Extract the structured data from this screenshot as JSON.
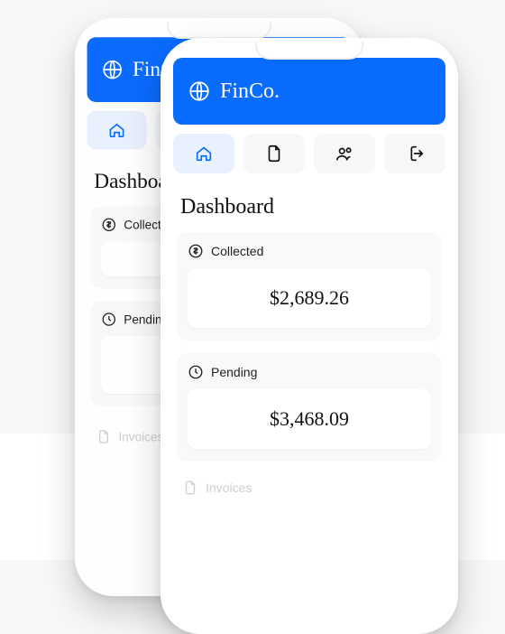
{
  "header": {
    "brand": "FinCo.",
    "icon": "globe-icon",
    "accent_color": "#0a6cff"
  },
  "nav": [
    {
      "name": "home",
      "icon": "home-icon",
      "active": true
    },
    {
      "name": "docs",
      "icon": "document-icon",
      "active": false
    },
    {
      "name": "people",
      "icon": "people-icon",
      "active": false
    },
    {
      "name": "logout",
      "icon": "logout-icon",
      "active": false
    }
  ],
  "page": {
    "title": "Dashboard"
  },
  "cards": [
    {
      "key": "collected",
      "label": "Collected",
      "icon": "dollar-icon",
      "value": "$2,689.26"
    },
    {
      "key": "pending",
      "label": "Pending",
      "icon": "clock-icon",
      "value": "$3,468.09"
    }
  ],
  "footer": {
    "invoices_label": "Invoices",
    "invoices_icon": "invoices-icon"
  }
}
